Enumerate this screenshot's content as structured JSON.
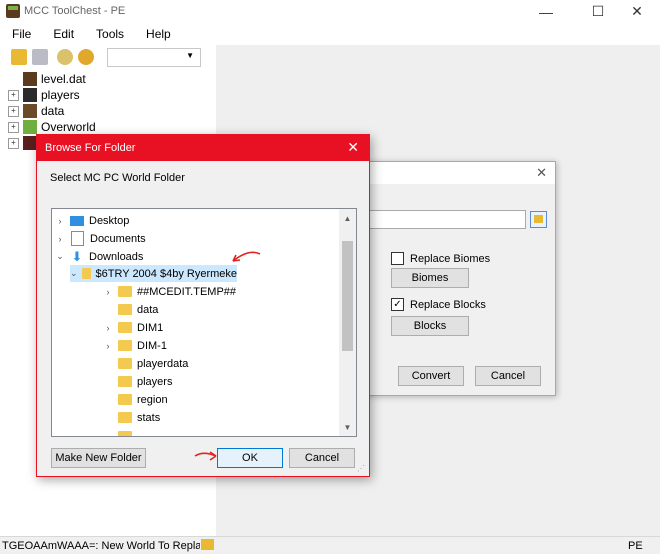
{
  "window": {
    "title": "MCC ToolChest - PE"
  },
  "menu": [
    "File",
    "Edit",
    "Tools",
    "Help"
  ],
  "toolbar": {
    "dropdown_value": ""
  },
  "tree": [
    {
      "label": "level.dat",
      "expander": ""
    },
    {
      "label": "players",
      "expander": "+"
    },
    {
      "label": "data",
      "expander": "+"
    },
    {
      "label": "Overworld",
      "expander": "+"
    }
  ],
  "status": {
    "text": "TGEOAAmWAAA=: New World To Replace",
    "mode": "PE"
  },
  "convert_dialog": {
    "replace_biomes_label": "Replace Biomes",
    "replace_biomes_checked": false,
    "biomes_button": "Biomes",
    "replace_blocks_label": "Replace Blocks",
    "replace_blocks_checked": true,
    "blocks_button": "Blocks",
    "convert_button": "Convert",
    "cancel_button": "Cancel"
  },
  "browse_dialog": {
    "title": "Browse For Folder",
    "label": "Select MC PC World Folder",
    "folders": [
      {
        "label": "Desktop",
        "chevron": "›",
        "icon": "desktop"
      },
      {
        "label": "Documents",
        "chevron": "›",
        "icon": "documents"
      },
      {
        "label": "Downloads",
        "chevron": "⌄",
        "icon": "downloads"
      },
      {
        "label": "$6TRY 2004 $4by Ryermeke",
        "chevron": "⌄",
        "icon": "folder",
        "selected": true
      },
      {
        "label": "##MCEDIT.TEMP##",
        "chevron": "›",
        "icon": "folder"
      },
      {
        "label": "data",
        "chevron": "",
        "icon": "folder"
      },
      {
        "label": "DIM1",
        "chevron": "›",
        "icon": "folder"
      },
      {
        "label": "DIM-1",
        "chevron": "›",
        "icon": "folder"
      },
      {
        "label": "playerdata",
        "chevron": "",
        "icon": "folder"
      },
      {
        "label": "players",
        "chevron": "",
        "icon": "folder"
      },
      {
        "label": "region",
        "chevron": "",
        "icon": "folder"
      },
      {
        "label": "stats",
        "chevron": "",
        "icon": "folder"
      }
    ],
    "new_folder_button": "Make New Folder",
    "ok_button": "OK",
    "cancel_button": "Cancel"
  },
  "annotations": {
    "arrow_color": "#e02424"
  }
}
